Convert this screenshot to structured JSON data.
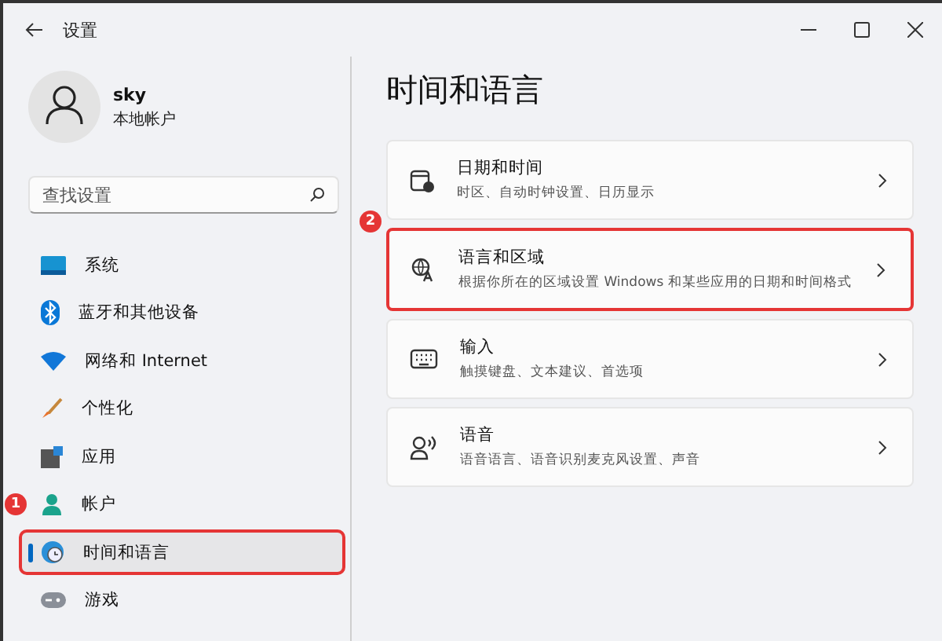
{
  "window": {
    "title": "设置"
  },
  "account": {
    "name": "sky",
    "type": "本地帐户"
  },
  "search": {
    "placeholder": "查找设置"
  },
  "sidebar": {
    "items": [
      {
        "label": "系统",
        "selected": false,
        "highlighted": false
      },
      {
        "label": "蓝牙和其他设备",
        "selected": false,
        "highlighted": false
      },
      {
        "label": "网络和 Internet",
        "selected": false,
        "highlighted": false
      },
      {
        "label": "个性化",
        "selected": false,
        "highlighted": false
      },
      {
        "label": "应用",
        "selected": false,
        "highlighted": false
      },
      {
        "label": "帐户",
        "selected": false,
        "highlighted": false,
        "callout": "1"
      },
      {
        "label": "时间和语言",
        "selected": true,
        "highlighted": true
      },
      {
        "label": "游戏",
        "selected": false,
        "highlighted": false
      }
    ]
  },
  "page": {
    "title": "时间和语言",
    "cards": [
      {
        "title": "日期和时间",
        "subtitle": "时区、自动时钟设置、日历显示",
        "highlighted": false
      },
      {
        "title": "语言和区域",
        "subtitle": "根据你所在的区域设置 Windows 和某些应用的日期和时间格式",
        "highlighted": true,
        "callout": "2"
      },
      {
        "title": "输入",
        "subtitle": "触摸键盘、文本建议、首选项",
        "highlighted": false
      },
      {
        "title": "语音",
        "subtitle": "语音语言、语音识别麦克风设置、声音",
        "highlighted": false
      }
    ]
  }
}
